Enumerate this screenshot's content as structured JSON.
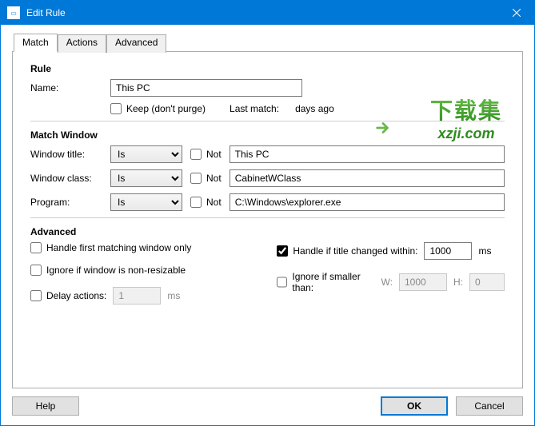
{
  "window": {
    "title": "Edit Rule"
  },
  "tabs": {
    "match": "Match",
    "actions": "Actions",
    "advanced": "Advanced"
  },
  "rule": {
    "heading": "Rule",
    "name_label": "Name:",
    "name_value": "This PC",
    "keep_label": "Keep (don't purge)",
    "keep_checked": false,
    "last_match_label": "Last match:",
    "last_match_value": "days ago"
  },
  "match": {
    "heading": "Match Window",
    "not_label": "Not",
    "op_is": "Is",
    "rows": {
      "title": {
        "label": "Window title:",
        "op": "Is",
        "not": false,
        "value": "This PC"
      },
      "class": {
        "label": "Window class:",
        "op": "Is",
        "not": false,
        "value": "CabinetWClass"
      },
      "program": {
        "label": "Program:",
        "op": "Is",
        "not": false,
        "value": "C:\\Windows\\explorer.exe"
      }
    }
  },
  "advanced": {
    "heading": "Advanced",
    "first_match_label": "Handle first matching window only",
    "ignore_nonresize_label": "Ignore if window is non-resizable",
    "delay_label": "Delay actions:",
    "delay_value": "1",
    "delay_unit": "ms",
    "title_changed_label": "Handle if title changed within:",
    "title_changed_value": "1000",
    "title_changed_unit": "ms",
    "ignore_smaller_label": "Ignore if smaller than:",
    "w_label": "W:",
    "h_label": "H:",
    "w_value": "1000",
    "h_value": "0"
  },
  "footer": {
    "help": "Help",
    "ok": "OK",
    "cancel": "Cancel"
  },
  "watermark": {
    "cn": "下载集",
    "url": "xzji.com"
  }
}
